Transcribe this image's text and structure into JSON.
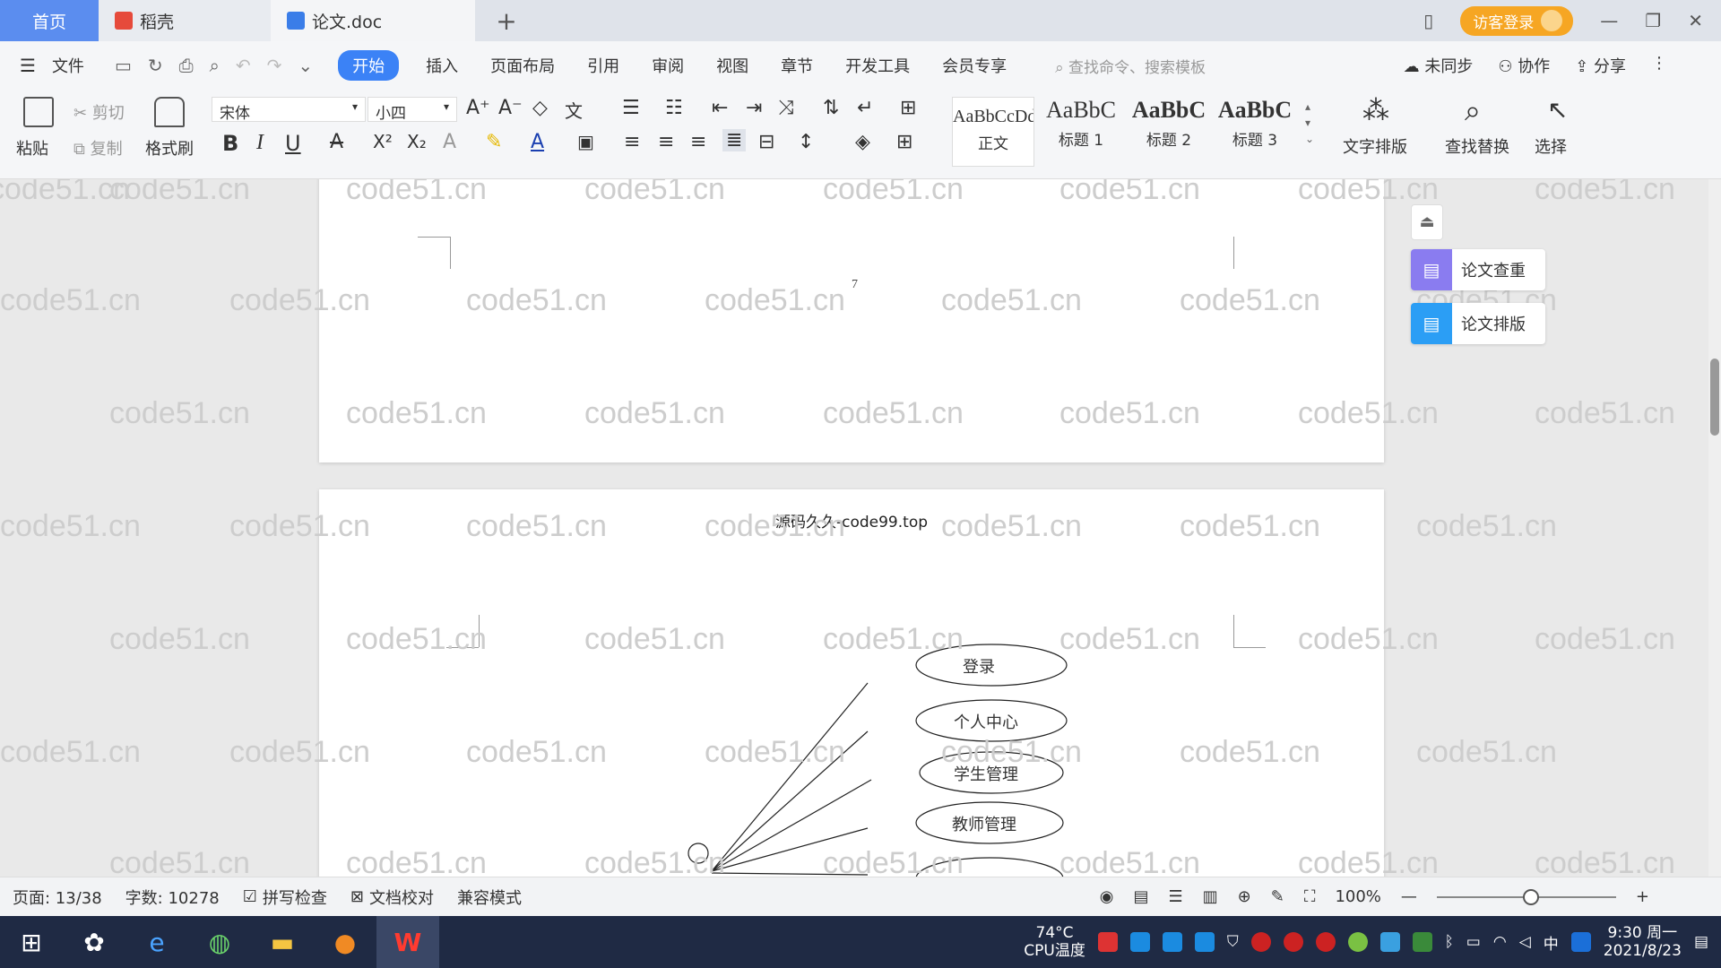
{
  "tabs": {
    "home": "首页",
    "daoke": "稻壳",
    "doc": "论文.doc",
    "add": "+"
  },
  "titlebar": {
    "login": "访客登录",
    "minimize": "—",
    "restore": "❐",
    "close": "✕"
  },
  "menubar": {
    "file": "文件",
    "items": [
      "开始",
      "插入",
      "页面布局",
      "引用",
      "审阅",
      "视图",
      "章节",
      "开发工具",
      "会员专享"
    ],
    "search": "查找命令、搜索模板",
    "unsync": "未同步",
    "collab": "协作",
    "share": "分享"
  },
  "ribbon": {
    "paste": "粘贴",
    "cut": "剪切",
    "copy": "复制",
    "format_painter": "格式刷",
    "font_name": "宋体",
    "font_size": "小四",
    "styles": [
      {
        "sample": "AaBbCcDd",
        "label": "正文"
      },
      {
        "sample": "AaBbC",
        "label": "标题 1"
      },
      {
        "sample": "AaBbC",
        "label": "标题 2"
      },
      {
        "sample": "AaBbC",
        "label": "标题 3"
      }
    ],
    "text_layout": "文字排版",
    "find_replace": "查找替换",
    "select": "选择"
  },
  "document": {
    "page_number": "7",
    "header": "源码久久-code99.top",
    "use_cases": [
      "登录",
      "个人中心",
      "学生管理",
      "教师管理"
    ]
  },
  "watermark": "code51.cn",
  "side_panel": {
    "check": "论文查重",
    "layout": "论文排版"
  },
  "statusbar": {
    "page": "页面: 13/38",
    "words": "字数: 10278",
    "spell": "拼写检查",
    "proof": "文档校对",
    "compat": "兼容模式",
    "zoom": "100%"
  },
  "taskbar": {
    "cpu_temp": "74°C",
    "cpu_label": "CPU温度",
    "ime": "中",
    "time": "9:30 周一",
    "date": "2021/8/23"
  }
}
